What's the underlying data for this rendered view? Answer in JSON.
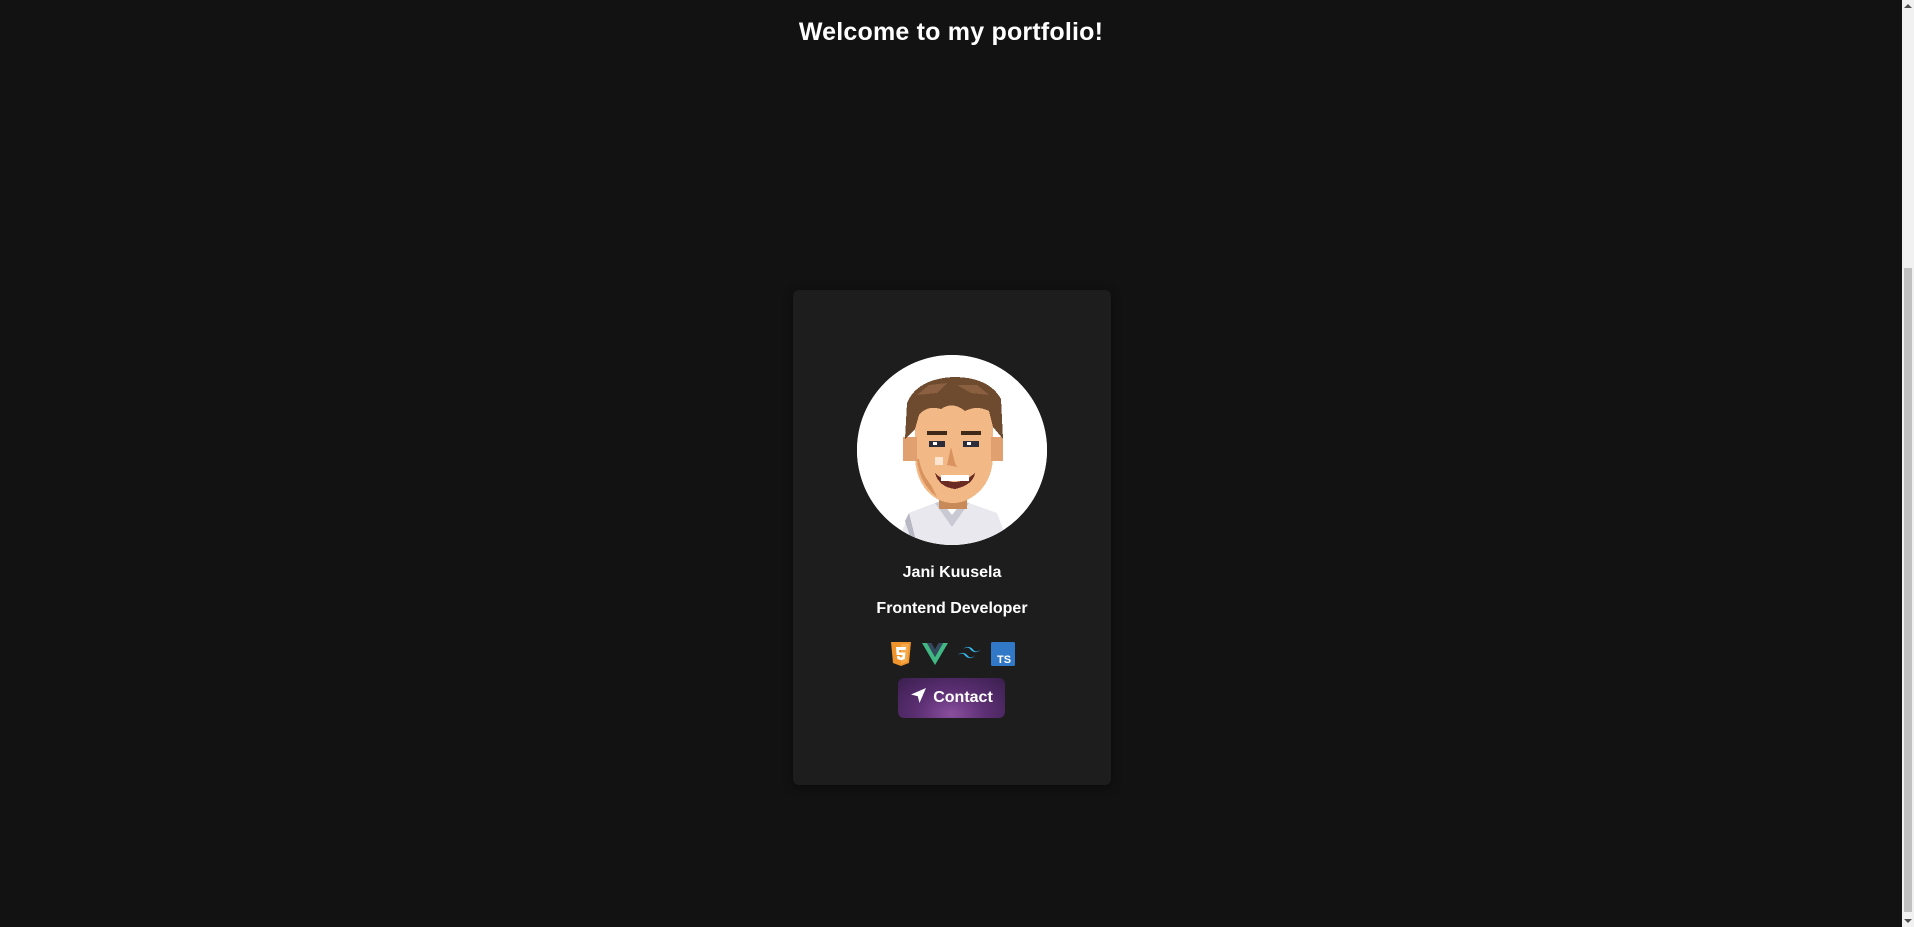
{
  "page": {
    "title": "Welcome to my portfolio!"
  },
  "profile": {
    "avatar_icon": "pixel-art-portrait",
    "name": "Jani Kuusela",
    "role": "Frontend Developer",
    "skills": [
      {
        "name": "html5-icon",
        "color": "#f0932b"
      },
      {
        "name": "vue-icon",
        "color": "#41b883"
      },
      {
        "name": "tailwind-icon",
        "color": "#38bdf8"
      },
      {
        "name": "typescript-icon",
        "color": "#3178c6",
        "label": "TS"
      }
    ],
    "contact_label": "Contact",
    "contact_icon": "paper-plane-icon"
  },
  "colors": {
    "background": "#121212",
    "card": "#1d1d1d",
    "button_accent": "#5c2f73"
  }
}
